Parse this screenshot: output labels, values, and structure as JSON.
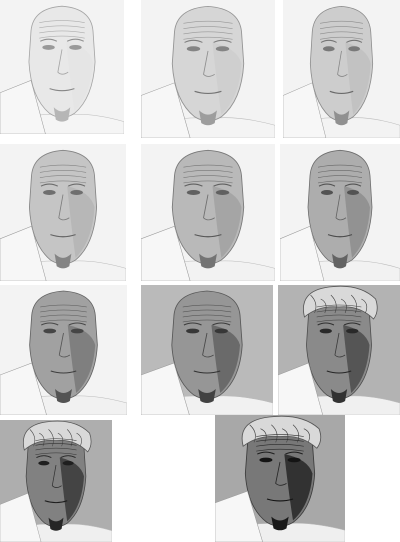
{
  "title": "",
  "colors": {
    "paper": "#f3f3f3",
    "ink": "#2a2a2a",
    "shadow": "#1a1a1a"
  },
  "stages": [
    {
      "stage": 1,
      "tone": 0.05,
      "hair": false,
      "background_dark": false
    },
    {
      "stage": 2,
      "tone": 0.2,
      "hair": false,
      "background_dark": false
    },
    {
      "stage": 3,
      "tone": 0.28,
      "hair": false,
      "background_dark": false
    },
    {
      "stage": 4,
      "tone": 0.35,
      "hair": false,
      "background_dark": false
    },
    {
      "stage": 5,
      "tone": 0.45,
      "hair": false,
      "background_dark": false
    },
    {
      "stage": 6,
      "tone": 0.55,
      "hair": false,
      "background_dark": false
    },
    {
      "stage": 7,
      "tone": 0.65,
      "hair": false,
      "background_dark": false
    },
    {
      "stage": 8,
      "tone": 0.75,
      "hair": false,
      "background_dark": true
    },
    {
      "stage": 9,
      "tone": 0.85,
      "hair": true,
      "background_dark": true
    },
    {
      "stage": 10,
      "tone": 0.92,
      "hair": true,
      "background_dark": true
    },
    {
      "stage": 11,
      "tone": 1.0,
      "hair": true,
      "background_dark": true
    }
  ]
}
